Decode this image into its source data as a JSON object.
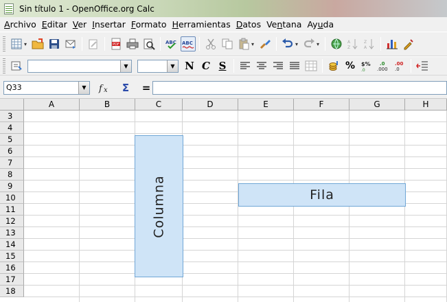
{
  "window": {
    "title": "Sin título 1 - OpenOffice.org Calc"
  },
  "menu": {
    "items": [
      {
        "key": "archivo",
        "accel": "A",
        "rest": "rchivo"
      },
      {
        "key": "editar",
        "accel": "E",
        "rest": "ditar"
      },
      {
        "key": "ver",
        "accel": "V",
        "rest": "er"
      },
      {
        "key": "insertar",
        "accel": "I",
        "rest": "nsertar"
      },
      {
        "key": "formato",
        "accel": "F",
        "rest": "ormato"
      },
      {
        "key": "herramientas",
        "accel": "H",
        "rest": "erramientas"
      },
      {
        "key": "datos",
        "accel": "D",
        "rest": "atos"
      },
      {
        "key": "ventana",
        "pre": "Ve",
        "accel": "n",
        "rest": "tana"
      },
      {
        "key": "ayuda",
        "pre": "Ay",
        "accel": "u",
        "rest": "da"
      }
    ]
  },
  "format_toolbar": {
    "bold": "N",
    "italic": "C",
    "underline": "S",
    "percent": "%",
    "currency": "$%",
    "add_decimal": ".0\n.000",
    "del_decimal": ".00\n.0"
  },
  "formula_bar": {
    "name_box": "Q33",
    "function_icon": "fx-icon",
    "sum_symbol": "Σ",
    "equals_symbol": "=",
    "input_value": ""
  },
  "sheet": {
    "columns": [
      "A",
      "B",
      "C",
      "D",
      "E",
      "F",
      "G",
      "H"
    ],
    "rows": [
      "3",
      "4",
      "5",
      "6",
      "7",
      "8",
      "9",
      "10",
      "11",
      "12",
      "13",
      "14",
      "15",
      "16",
      "17",
      "18"
    ],
    "shapes": {
      "column_label": "Columna",
      "row_label": "Fila",
      "fill_color": "#cfe4f7",
      "border_color": "#6fa6d6"
    }
  }
}
